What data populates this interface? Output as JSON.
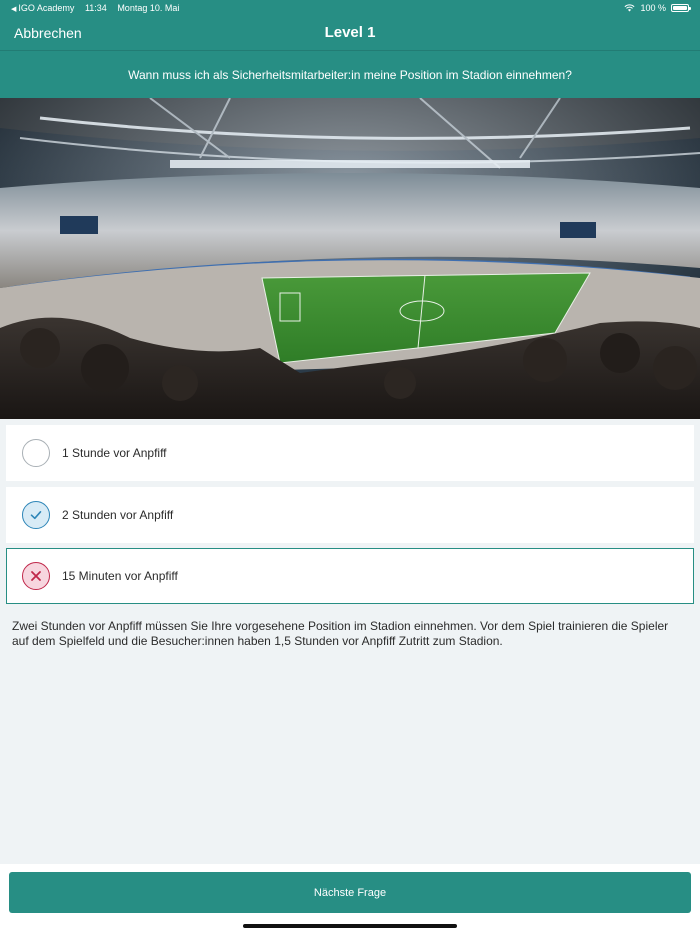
{
  "status_bar": {
    "back_app": "IGO Academy",
    "time": "11:34",
    "date": "Montag 10. Mai",
    "battery": "100 %"
  },
  "nav": {
    "cancel_label": "Abbrechen",
    "title": "Level 1"
  },
  "question": "Wann muss ich als Sicherheitsmitarbeiter:in meine Position im Stadion einnehmen?",
  "answers": [
    {
      "label": "1 Stunde vor Anpfiff",
      "state": "unselected"
    },
    {
      "label": "2 Stunden vor Anpfiff",
      "state": "correct"
    },
    {
      "label": "15 Minuten vor Anpfiff",
      "state": "incorrect"
    }
  ],
  "explanation": "Zwei Stunden vor Anpfiff müssen Sie Ihre vorgesehene Position im Stadion einnehmen. Vor dem Spiel trainieren die Spieler auf dem Spielfeld und die Besucher:innen haben 1,5 Stunden vor Anpfiff Zutritt zum Stadion.",
  "footer": {
    "next_label": "Nächste Frage"
  },
  "colors": {
    "accent": "#278e84",
    "correct": "#2e86b8",
    "incorrect": "#c0274a"
  }
}
